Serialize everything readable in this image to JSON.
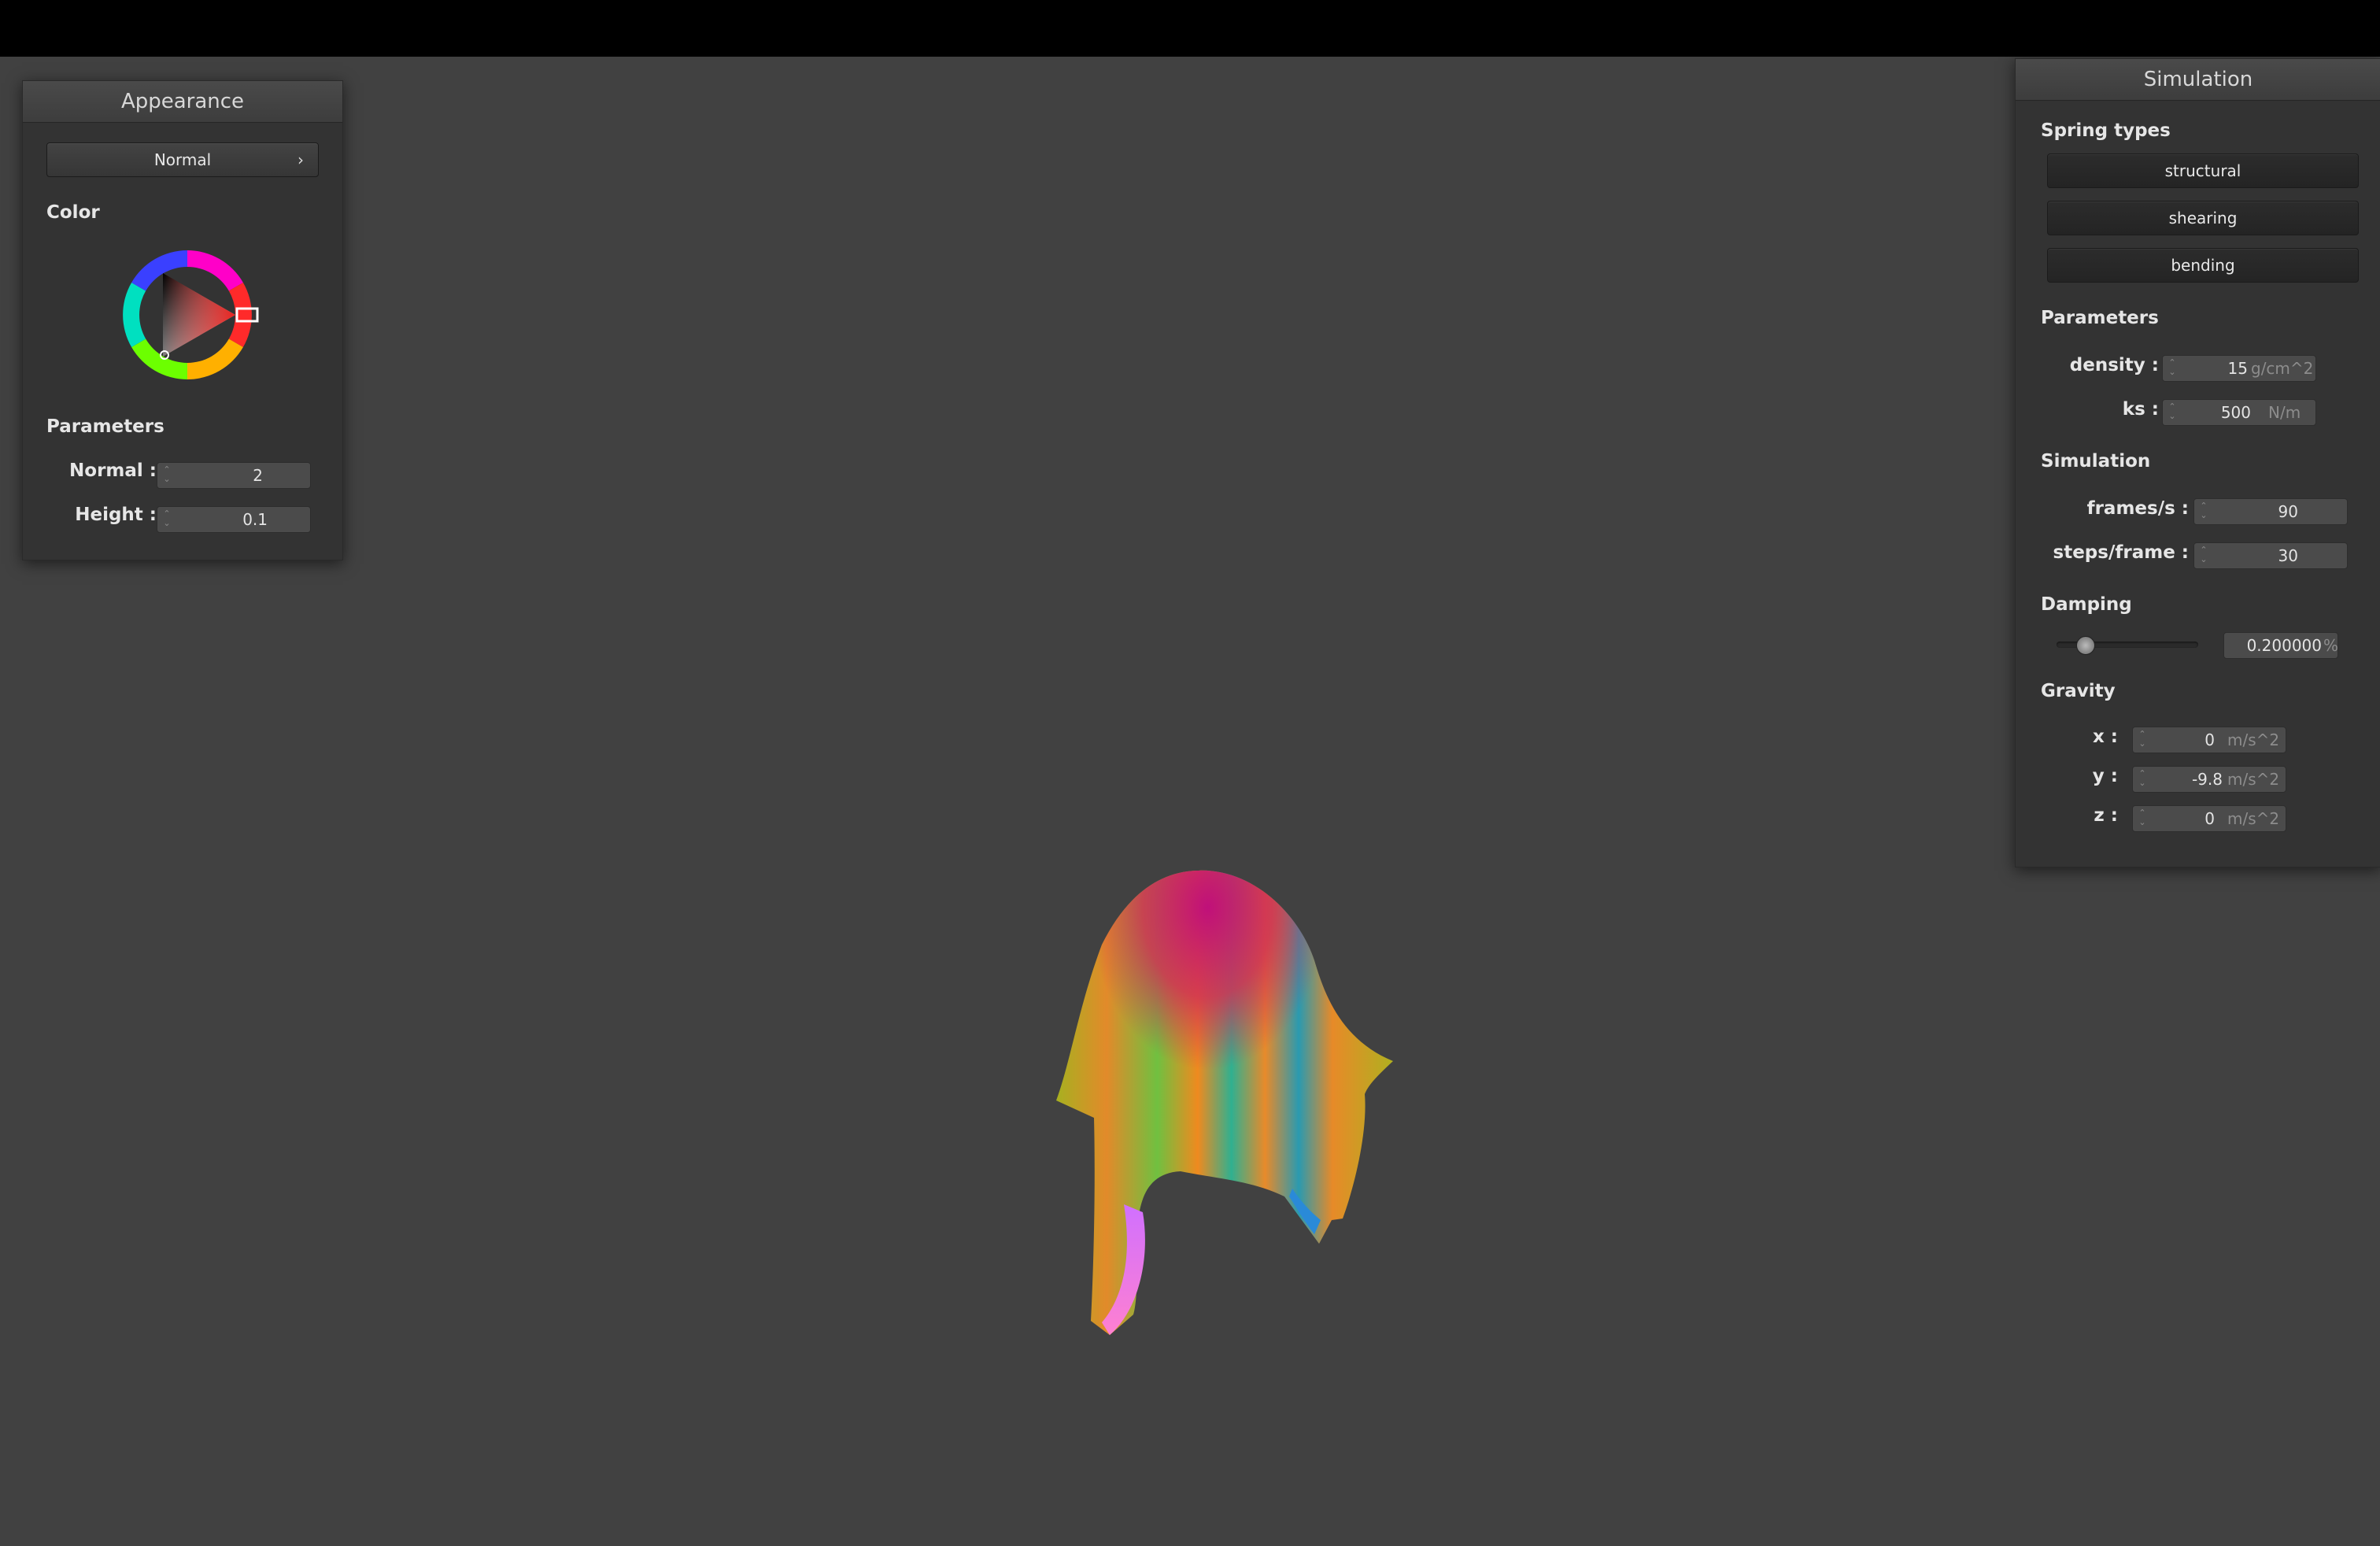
{
  "appearance": {
    "title": "Appearance",
    "shader_select": {
      "value": "Normal"
    },
    "color_label": "Color",
    "parameters_label": "Parameters",
    "params": [
      {
        "label": "Normal :",
        "value": "2"
      },
      {
        "label": "Height :",
        "value": "0.1"
      }
    ]
  },
  "simulation": {
    "title": "Simulation",
    "spring_types_label": "Spring types",
    "springs": [
      "structural",
      "shearing",
      "bending"
    ],
    "parameters_label": "Parameters",
    "density": {
      "label": "density :",
      "value": "15",
      "unit": "g/cm^2"
    },
    "ks": {
      "label": "ks :",
      "value": "500",
      "unit": "N/m"
    },
    "sim_label": "Simulation",
    "frames": {
      "label": "frames/s :",
      "value": "90"
    },
    "steps": {
      "label": "steps/frame :",
      "value": "30"
    },
    "damping_label": "Damping",
    "damping": {
      "value": "0.200000",
      "unit": "%",
      "slider_fraction": 0.2
    },
    "gravity_label": "Gravity",
    "gravity": [
      {
        "label": "x :",
        "value": "0",
        "unit": "m/s^2"
      },
      {
        "label": "y :",
        "value": "-9.8",
        "unit": "m/s^2"
      },
      {
        "label": "z :",
        "value": "0",
        "unit": "m/s^2"
      }
    ]
  },
  "colors": {
    "background": "#414141",
    "panel": "#333333",
    "selected_color": "#e8221f"
  }
}
